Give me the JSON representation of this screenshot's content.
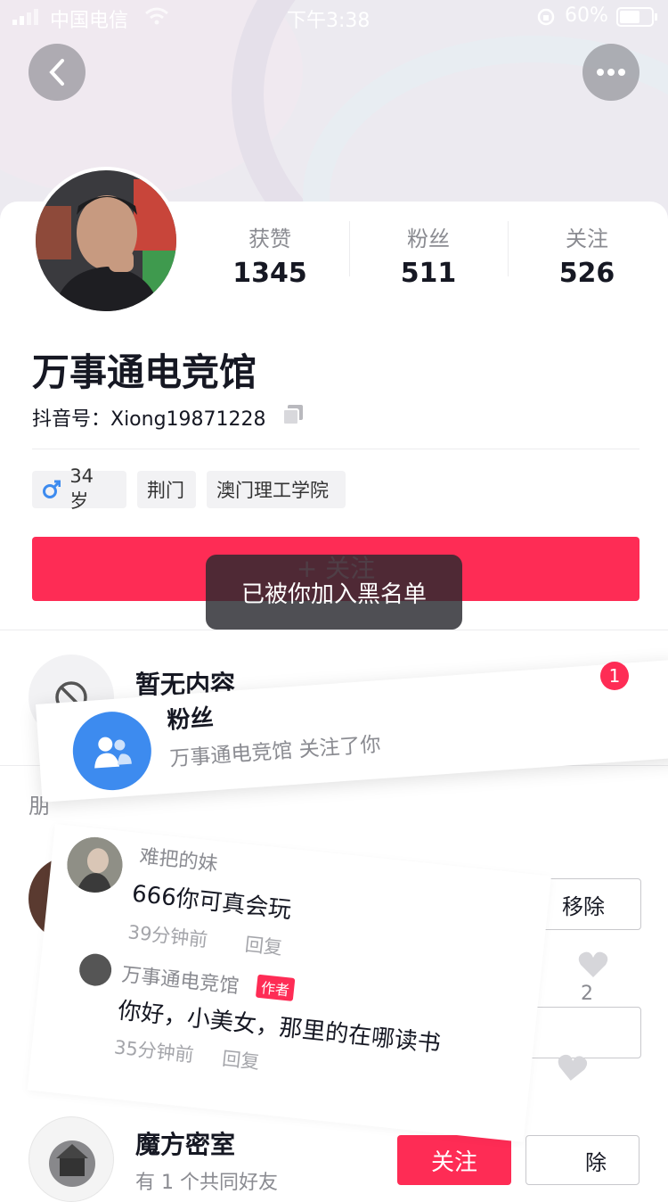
{
  "status_bar": {
    "carrier": "中国电信",
    "time": "下午3:38",
    "battery": "60%"
  },
  "profile": {
    "name": "万事通电竞馆",
    "douyin_id": "抖音号：Xiong19871228",
    "stats": [
      {
        "label": "获赞",
        "value": "1345"
      },
      {
        "label": "粉丝",
        "value": "511"
      },
      {
        "label": "关注",
        "value": "526"
      }
    ],
    "tags": {
      "age": "34 岁",
      "city": "荆门",
      "school": "澳门理工学院"
    },
    "follow_label": "+ 关注"
  },
  "toast": "已被你加入黑名单",
  "empty": {
    "title": "暂无内容"
  },
  "partial_section_char": "朋",
  "fans_notification": {
    "title": "粉丝",
    "subtitle": "万事通电竞馆 关注了你",
    "badge": "1"
  },
  "comments": [
    {
      "user": "难把的妹",
      "text": "666你可真会玩",
      "time": "39分钟前",
      "reply": "回复",
      "likes": "2"
    },
    {
      "user": "万事通电竞馆",
      "author_tag": "作者",
      "text": "你好，小美女，那里的在哪读书",
      "time": "35分钟前",
      "reply": "回复"
    }
  ],
  "recommend": [
    {
      "remove_label": "移除"
    },
    {
      "name": "魔方密室",
      "subtitle": "有 1 个共同好友",
      "follow_label": "关注",
      "remove_label": "除"
    }
  ],
  "colors": {
    "accent": "#fe2c55",
    "fans_icon": "#3d8bef"
  }
}
